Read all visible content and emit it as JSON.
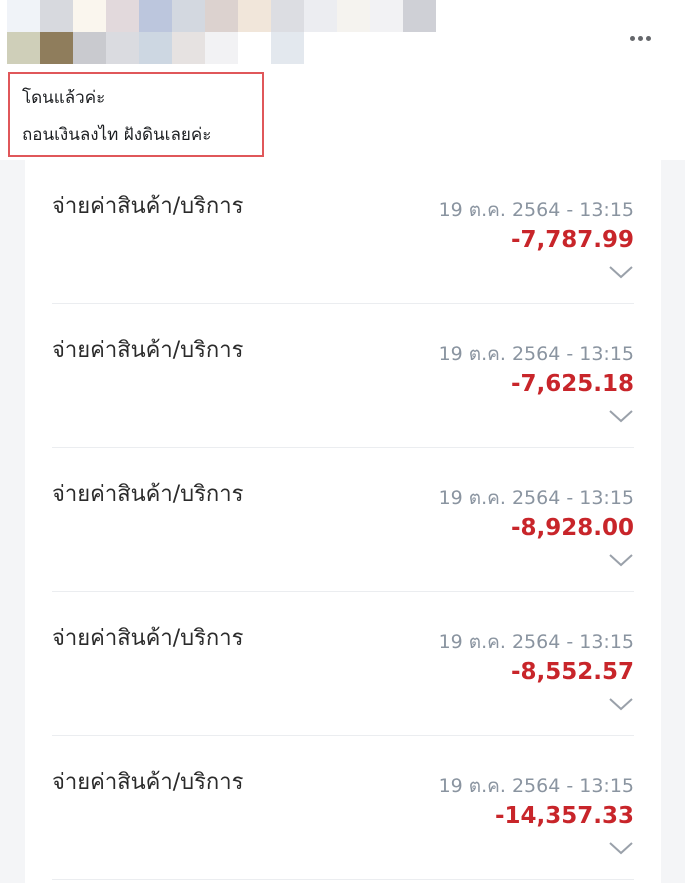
{
  "post": {
    "caption_line1": "โดนแล้วค่ะ",
    "caption_line2": "ถอนเงินลงไท ฝังดินเลยค่ะ",
    "more_icon": "more-horizontal-icon",
    "highlight_color": "#e0575a"
  },
  "transactions": [
    {
      "title": "จ่ายค่าสินค้า/บริการ",
      "datetime": "19 ต.ค. 2564 - 13:15",
      "amount": "-7,787.99"
    },
    {
      "title": "จ่ายค่าสินค้า/บริการ",
      "datetime": "19 ต.ค. 2564 - 13:15",
      "amount": "-7,625.18"
    },
    {
      "title": "จ่ายค่าสินค้า/บริการ",
      "datetime": "19 ต.ค. 2564 - 13:15",
      "amount": "-8,928.00"
    },
    {
      "title": "จ่ายค่าสินค้า/บริการ",
      "datetime": "19 ต.ค. 2564 - 13:15",
      "amount": "-8,552.57"
    },
    {
      "title": "จ่ายค่าสินค้า/บริการ",
      "datetime": "19 ต.ค. 2564 - 13:15",
      "amount": "-14,357.33"
    }
  ],
  "colors": {
    "amount_negative": "#c8252a",
    "date_text": "#8a94a0"
  },
  "icons": {
    "expand": "chevron-down-icon"
  }
}
